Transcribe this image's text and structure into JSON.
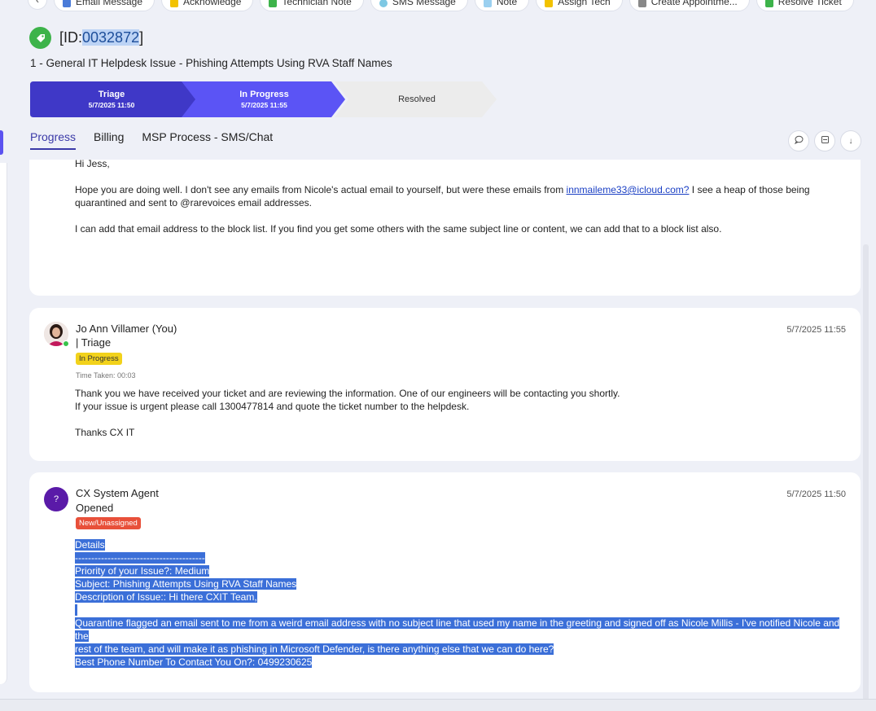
{
  "toolbar": {
    "buttons": [
      {
        "label": "Email Message",
        "color": "#4a7bd8"
      },
      {
        "label": "Acknowledge",
        "color": "#f2c200"
      },
      {
        "label": "Technician Note",
        "color": "#3db34a"
      },
      {
        "label": "SMS Message",
        "color": "#7ec8e3"
      },
      {
        "label": "Note",
        "color": "#9bd0f0"
      },
      {
        "label": "Assign Tech",
        "color": "#f2c200"
      },
      {
        "label": "Create Appointme...",
        "color": "#888888"
      },
      {
        "label": "Resolve Ticket",
        "color": "#3db34a"
      }
    ]
  },
  "ticket": {
    "id_prefix": "[ID:",
    "id_number": "0032872",
    "id_suffix": "]",
    "title": "1 - General IT Helpdesk Issue - Phishing Attempts Using RVA Staff Names"
  },
  "stages": [
    {
      "name": "Triage",
      "time": "5/7/2025 11:50",
      "color": "#3f38c7"
    },
    {
      "name": "In Progress",
      "time": "5/7/2025 11:55",
      "color": "#5b54f5"
    },
    {
      "name": "Resolved",
      "time": "",
      "color": "#ececec"
    }
  ],
  "tabs": [
    "Progress",
    "Billing",
    "MSP Process - SMS/Chat"
  ],
  "entries": {
    "first": {
      "greeting": "Hi Jess,",
      "para1_before": "Hope you are doing well. I don't see any emails from Nicole's actual email to yourself, but were these emails from ",
      "para1_link": "innmaileme33@icloud.com?",
      "para1_after": " I see a heap of those being quarantined and sent to @rarevoices email addresses.",
      "para2": "I can add that email address to the block list. If you find you get some others with the same subject line or content, we can add that to a block list also."
    },
    "second": {
      "author": "Jo Ann Villamer (You)",
      "stage": "| Triage",
      "badge": "In Progress",
      "badge_color": "#f2d21b",
      "time_taken": "Time Taken: 00:03",
      "timestamp": "5/7/2025 11:55",
      "line1": "Thank you we have received your ticket and are reviewing the information. One of our engineers will be contacting you shortly.",
      "line2": "If your issue is urgent please call 1300477814 and quote the ticket number to the helpdesk.",
      "line3": "Thanks CX IT"
    },
    "third": {
      "author": "CX System Agent",
      "avatar_letter": "?",
      "avatar_color": "#5a1aa8",
      "stage": "Opened",
      "badge": "New/Unassigned",
      "badge_color": "#e8503a",
      "timestamp": "5/7/2025 11:50",
      "details": "Details",
      "divider": "----------------------------------------",
      "priority": "Priority of your Issue?: Medium",
      "subject": "Subject: Phishing Attempts Using RVA Staff Names",
      "description": "Description of Issue:: Hi there CXIT Team,",
      "body_line1": "Quarantine flagged an email sent to me from a weird email address with no subject line that used my name in the greeting and signed off as Nicole Millis - I've notified Nicole and the",
      "body_line2": "rest of the team, and will make it as phishing in Microsoft Defender, is there anything else that we can do here?",
      "phone": "Best Phone Number To Contact You On?: 0499230625"
    }
  }
}
